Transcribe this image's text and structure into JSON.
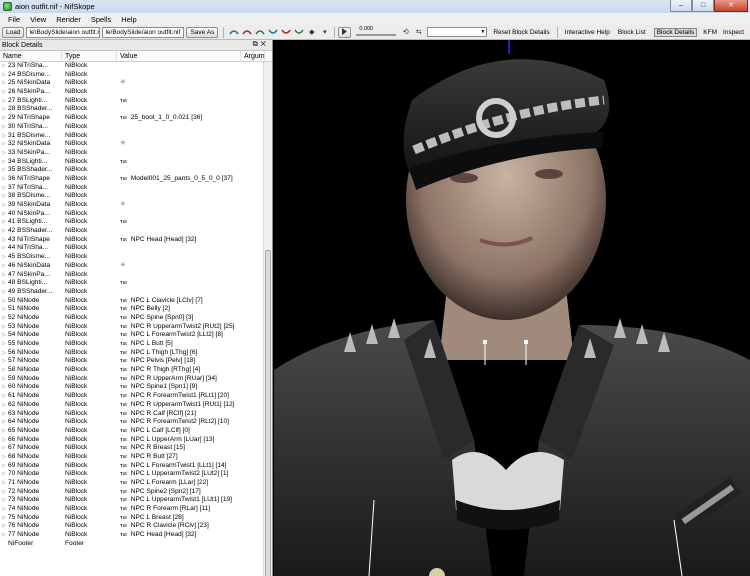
{
  "window": {
    "title": "aion outfit.nif - NifSkope",
    "min": "–",
    "max": "□",
    "close": "✕"
  },
  "menu": [
    "File",
    "View",
    "Render",
    "Spells",
    "Help"
  ],
  "toolbar": {
    "load": "Load",
    "load_path": "le\\BodySlide\\aion outfit.nif",
    "save_path": "le/BodySlide/aion outfit.nif",
    "save_as": "Save As",
    "slider_value": "0.000",
    "reset_block_details": "Reset Block Details",
    "interactive_help": "Interactive Help",
    "block_list": "Block List",
    "block_details": "Block Details",
    "kfm": "KFM",
    "inspect": "Inspect"
  },
  "panel": {
    "title": "Block Details",
    "columns": {
      "name": "Name",
      "type": "Type",
      "value": "Value",
      "argument": "Argum"
    },
    "rows": [
      {
        "name": "23 NiTriSha...",
        "type": "NiBlock",
        "value": "",
        "badge": ""
      },
      {
        "name": "24 BSDisme...",
        "type": "NiBlock",
        "value": "",
        "badge": ""
      },
      {
        "name": "25 NiSkinData",
        "type": "NiBlock",
        "value": "",
        "badge": "star"
      },
      {
        "name": "26 NiSkinPa...",
        "type": "NiBlock",
        "value": "",
        "badge": ""
      },
      {
        "name": "27 BSLighti...",
        "type": "NiBlock",
        "value": "",
        "badge": "Txt"
      },
      {
        "name": "28 BSShader...",
        "type": "NiBlock",
        "value": "",
        "badge": ""
      },
      {
        "name": "29 NiTriShape",
        "type": "NiBlock",
        "value": "25_boot_1_0_0.021 [36]",
        "badge": "Txt"
      },
      {
        "name": "30 NiTriSha...",
        "type": "NiBlock",
        "value": "",
        "badge": ""
      },
      {
        "name": "31 BSDisme...",
        "type": "NiBlock",
        "value": "",
        "badge": ""
      },
      {
        "name": "32 NiSkinData",
        "type": "NiBlock",
        "value": "",
        "badge": "star"
      },
      {
        "name": "33 NiSkinPa...",
        "type": "NiBlock",
        "value": "",
        "badge": ""
      },
      {
        "name": "34 BSLighti...",
        "type": "NiBlock",
        "value": "",
        "badge": "Txt"
      },
      {
        "name": "35 BSShader...",
        "type": "NiBlock",
        "value": "",
        "badge": ""
      },
      {
        "name": "36 NiTriShape",
        "type": "NiBlock",
        "value": "Model001_25_pants_0_5_0_0 [37]",
        "badge": "Txt"
      },
      {
        "name": "37 NiTriSha...",
        "type": "NiBlock",
        "value": "",
        "badge": ""
      },
      {
        "name": "38 BSDisme...",
        "type": "NiBlock",
        "value": "",
        "badge": ""
      },
      {
        "name": "39 NiSkinData",
        "type": "NiBlock",
        "value": "",
        "badge": "star"
      },
      {
        "name": "40 NiSkinPa...",
        "type": "NiBlock",
        "value": "",
        "badge": ""
      },
      {
        "name": "41 BSLighti...",
        "type": "NiBlock",
        "value": "",
        "badge": "Txt"
      },
      {
        "name": "42 BSShader...",
        "type": "NiBlock",
        "value": "",
        "badge": ""
      },
      {
        "name": "43 NiTriShape",
        "type": "NiBlock",
        "value": "NPC Head [Head] [32]",
        "badge": "Txt"
      },
      {
        "name": "44 NiTriSha...",
        "type": "NiBlock",
        "value": "",
        "badge": ""
      },
      {
        "name": "45 BSDisme...",
        "type": "NiBlock",
        "value": "",
        "badge": ""
      },
      {
        "name": "46 NiSkinData",
        "type": "NiBlock",
        "value": "",
        "badge": "star"
      },
      {
        "name": "47 NiSkinPa...",
        "type": "NiBlock",
        "value": "",
        "badge": ""
      },
      {
        "name": "48 BSLighti...",
        "type": "NiBlock",
        "value": "",
        "badge": "Txt"
      },
      {
        "name": "49 BSShader...",
        "type": "NiBlock",
        "value": "",
        "badge": ""
      },
      {
        "name": "50 NiNode",
        "type": "NiBlock",
        "value": "NPC L Clavicle [LClv] [7]",
        "badge": "Txt"
      },
      {
        "name": "51 NiNode",
        "type": "NiBlock",
        "value": "NPC Belly [2]",
        "badge": "Txt"
      },
      {
        "name": "52 NiNode",
        "type": "NiBlock",
        "value": "NPC Spine [Spn0] [3]",
        "badge": "Txt"
      },
      {
        "name": "53 NiNode",
        "type": "NiBlock",
        "value": "NPC R UpperarmTwist2 [RUt2] [25]",
        "badge": "Txt"
      },
      {
        "name": "54 NiNode",
        "type": "NiBlock",
        "value": "NPC L ForearmTwist2 [LLt2] [8]",
        "badge": "Txt"
      },
      {
        "name": "55 NiNode",
        "type": "NiBlock",
        "value": "NPC L Butt [5]",
        "badge": "Txt"
      },
      {
        "name": "56 NiNode",
        "type": "NiBlock",
        "value": "NPC L Thigh [LThg] [6]",
        "badge": "Txt"
      },
      {
        "name": "57 NiNode",
        "type": "NiBlock",
        "value": "NPC Pelvis [Pelv] [18]",
        "badge": "Txt"
      },
      {
        "name": "58 NiNode",
        "type": "NiBlock",
        "value": "NPC R Thigh [RThg] [4]",
        "badge": "Txt"
      },
      {
        "name": "59 NiNode",
        "type": "NiBlock",
        "value": "NPC R UpperArm [RUar] [34]",
        "badge": "Txt"
      },
      {
        "name": "60 NiNode",
        "type": "NiBlock",
        "value": "NPC Spine1 [Spn1] [9]",
        "badge": "Txt"
      },
      {
        "name": "61 NiNode",
        "type": "NiBlock",
        "value": "NPC R ForearmTwist1 [RLt1] [20]",
        "badge": "Txt"
      },
      {
        "name": "62 NiNode",
        "type": "NiBlock",
        "value": "NPC R UpperarmTwist1 [RUt1] [12]",
        "badge": "Txt"
      },
      {
        "name": "63 NiNode",
        "type": "NiBlock",
        "value": "NPC R Calf [RClf] [21]",
        "badge": "Txt"
      },
      {
        "name": "64 NiNode",
        "type": "NiBlock",
        "value": "NPC R ForearmTwist2 [RLt2] [10]",
        "badge": "Txt"
      },
      {
        "name": "65 NiNode",
        "type": "NiBlock",
        "value": "NPC L Calf [LClf] [0]",
        "badge": "Txt"
      },
      {
        "name": "66 NiNode",
        "type": "NiBlock",
        "value": "NPC L UpperArm [LUar] [13]",
        "badge": "Txt"
      },
      {
        "name": "67 NiNode",
        "type": "NiBlock",
        "value": "NPC R Breast [15]",
        "badge": "Txt"
      },
      {
        "name": "68 NiNode",
        "type": "NiBlock",
        "value": "NPC R Butt [27]",
        "badge": "Txt"
      },
      {
        "name": "69 NiNode",
        "type": "NiBlock",
        "value": "NPC L ForearmTwist1 [LLt1] [14]",
        "badge": "Txt"
      },
      {
        "name": "70 NiNode",
        "type": "NiBlock",
        "value": "NPC L UpperarmTwist2 [LUt2] [1]",
        "badge": "Txt"
      },
      {
        "name": "71 NiNode",
        "type": "NiBlock",
        "value": "NPC L Forearm [LLar] [22]",
        "badge": "Txt"
      },
      {
        "name": "72 NiNode",
        "type": "NiBlock",
        "value": "NPC Spine2 [Spn2] [17]",
        "badge": "Txt"
      },
      {
        "name": "73 NiNode",
        "type": "NiBlock",
        "value": "NPC L UpperarmTwist1 [LUt1] [19]",
        "badge": "Txt"
      },
      {
        "name": "74 NiNode",
        "type": "NiBlock",
        "value": "NPC R Forearm [RLar] [11]",
        "badge": "Txt"
      },
      {
        "name": "75 NiNode",
        "type": "NiBlock",
        "value": "NPC L Breast [28]",
        "badge": "Txt"
      },
      {
        "name": "76 NiNode",
        "type": "NiBlock",
        "value": "NPC R Clavicle [RClv] [23]",
        "badge": "Txt"
      },
      {
        "name": "77 NiNode",
        "type": "NiBlock",
        "value": "NPC Head [Head] [32]",
        "badge": "Txt"
      },
      {
        "name": "NiFooter",
        "type": "Footer",
        "value": "",
        "badge": ""
      }
    ]
  },
  "badge_text": "Txt",
  "colors": {
    "titlebar": "#c9d8ee",
    "viewport_bg": "#000000",
    "axis_line": "#2233ff"
  }
}
